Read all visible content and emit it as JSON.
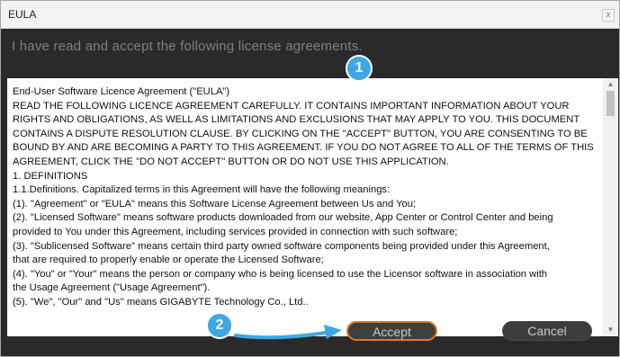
{
  "window": {
    "title": "EULA",
    "close_label": "x"
  },
  "dialog": {
    "heading": "I have read and accept the following license agreements."
  },
  "eula": {
    "lines": [
      "End-User Software Licence Agreement (\"EULA\")",
      "READ THE FOLLOWING LICENCE AGREEMENT CAREFULLY. IT CONTAINS IMPORTANT INFORMATION ABOUT YOUR",
      "RIGHTS AND OBLIGATIONS, AS WELL AS LIMITATIONS AND EXCLUSIONS THAT MAY APPLY TO YOU. THIS DOCUMENT",
      "CONTAINS A DISPUTE RESOLUTION CLAUSE. BY CLICKING ON THE \"ACCEPT\" BUTTON, YOU ARE CONSENTING TO BE",
      "BOUND BY AND ARE BECOMING A PARTY TO THIS AGREEMENT. IF YOU DO NOT AGREE TO ALL OF THE TERMS OF THIS",
      "AGREEMENT, CLICK THE \"DO NOT ACCEPT\" BUTTON OR DO NOT USE THIS APPLICATION.",
      "1. DEFINITIONS",
      "1.1.Definitions. Capitalized terms in this Agreement will have the following meanings:",
      "(1). \"Agreement\" or \"EULA\" means this Software License Agreement between Us and You;",
      "(2). \"Licensed Software\" means software products downloaded from our website, App Center or Control Center and being",
      "provided to You under this Agreement, including services provided in connection with such software;",
      "(3). \"Sublicensed Software\" means certain third party owned software components being provided under this Agreement,",
      "that are required to properly enable or operate the Licensed Software;",
      "(4). \"You\" or \"Your\" means the person or company who is being licensed to use the Licensor software in association with",
      "the Usage Agreement (\"Usage Agreement\").",
      "(5). \"We\", \"Our\" and \"Us\" means GIGABYTE Technology Co., Ltd.."
    ]
  },
  "buttons": {
    "accept": "Accept",
    "cancel": "Cancel"
  },
  "annotations": {
    "marker1": "1",
    "marker2": "2"
  },
  "colors": {
    "marker": "#3da8e8",
    "accept_border": "#e2781c",
    "dialog_bg": "#2a2a2a"
  }
}
